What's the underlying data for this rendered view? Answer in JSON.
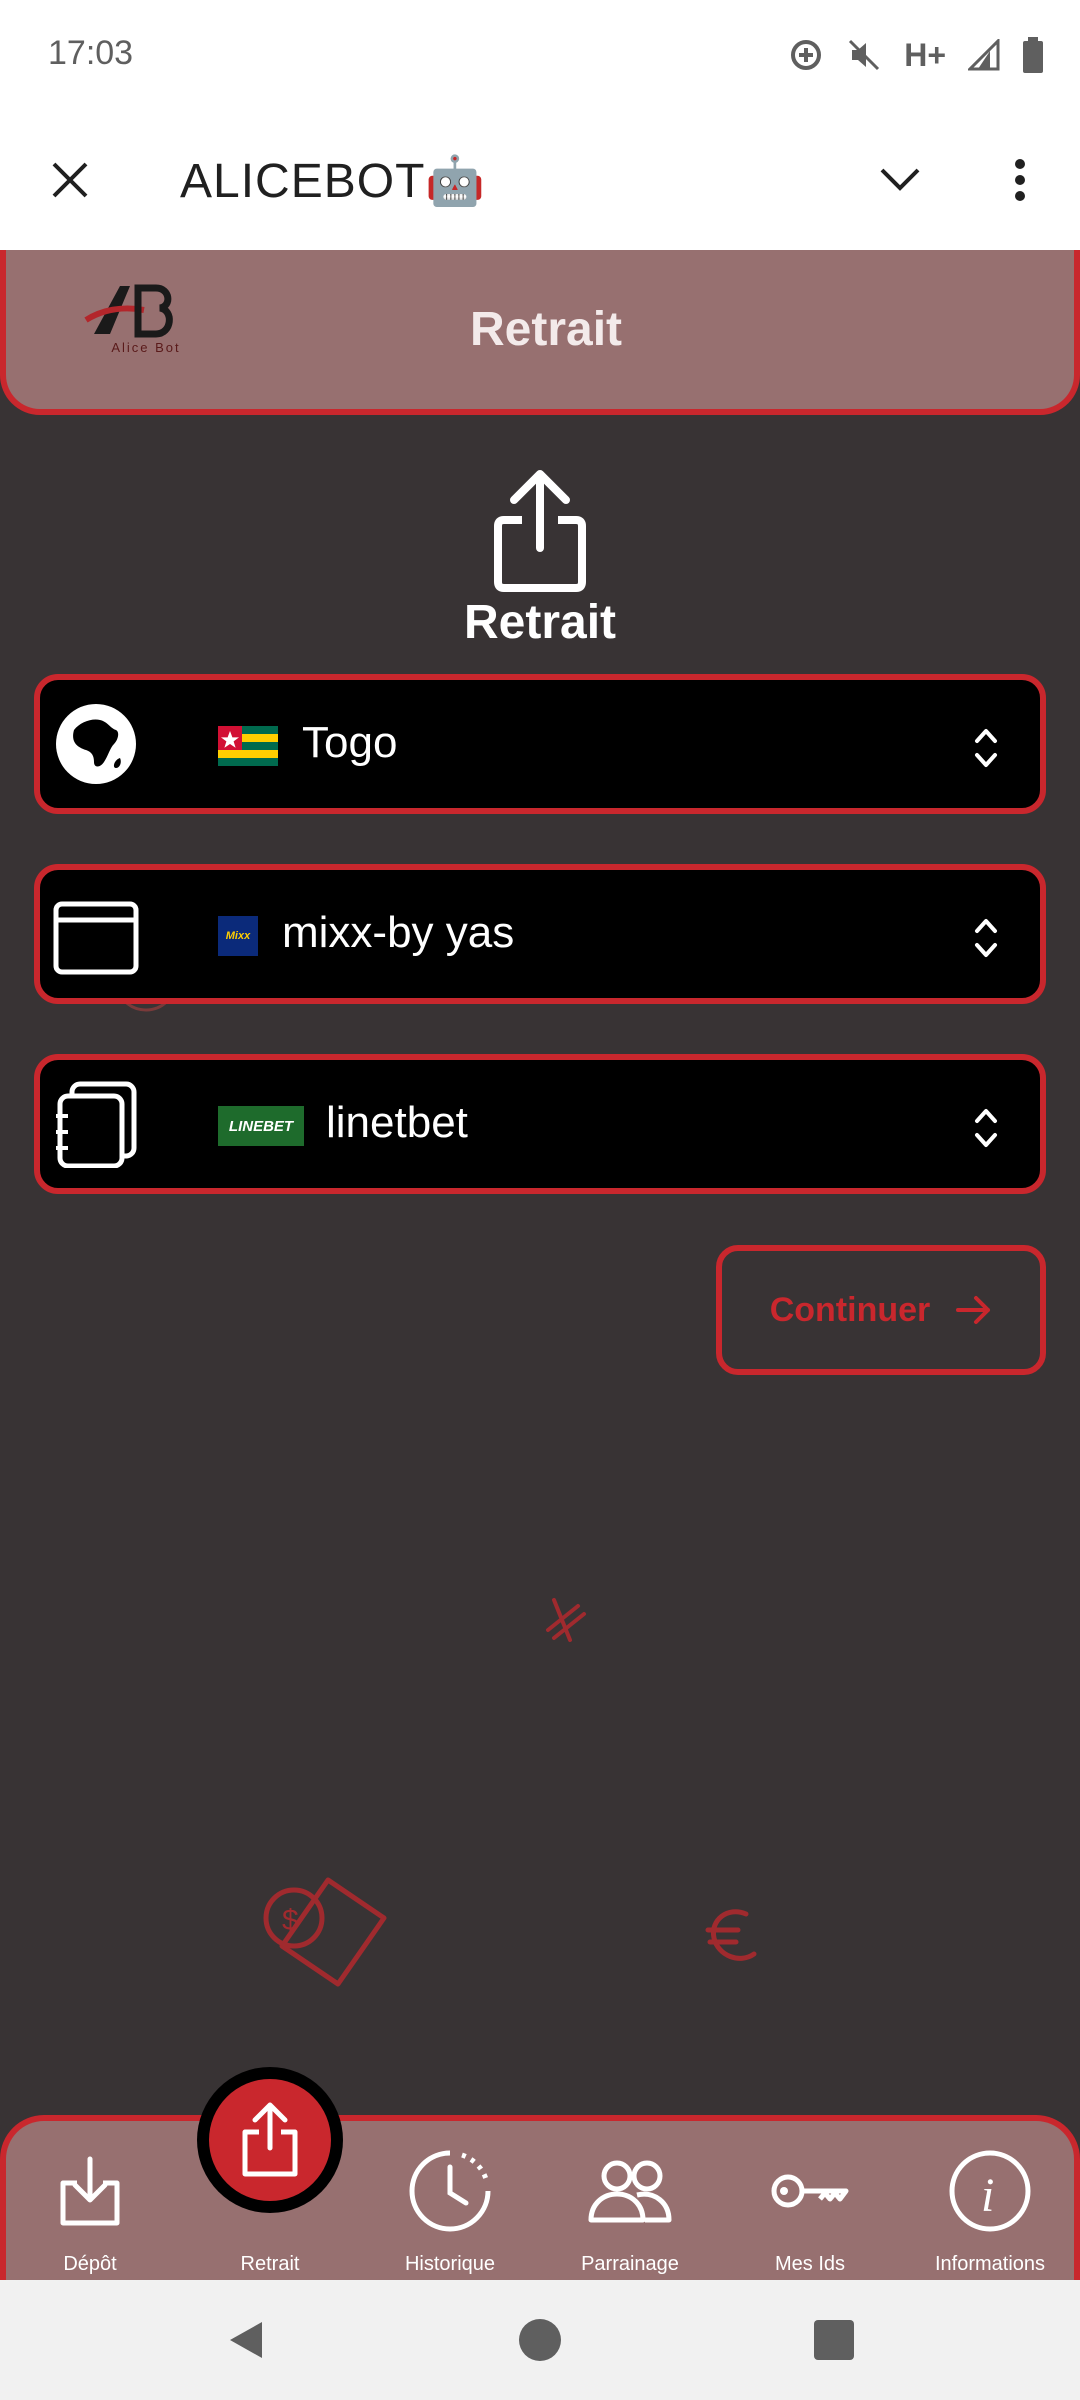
{
  "status_bar": {
    "time": "17:03",
    "network": "H+"
  },
  "app_bar": {
    "title": "ALICEBOT🤖"
  },
  "header": {
    "logo_text": "Alice Bot",
    "title": "Retrait"
  },
  "main": {
    "heading": "Retrait",
    "country_select": {
      "value": "Togo",
      "icon": "globe-africa-icon"
    },
    "provider_select": {
      "value": "mixx-by yas",
      "badge": "Mixx"
    },
    "bookmaker_select": {
      "value": "linetbet",
      "badge": "LINEBET"
    },
    "continue_label": "Continuer"
  },
  "bottom_nav": {
    "items": [
      {
        "label": "Dépôt",
        "icon": "download-icon"
      },
      {
        "label": "Retrait",
        "icon": "upload-icon"
      },
      {
        "label": "Historique",
        "icon": "clock-icon"
      },
      {
        "label": "Parrainage",
        "icon": "users-icon"
      },
      {
        "label": "Mes Ids",
        "icon": "key-icon"
      },
      {
        "label": "Informations",
        "icon": "info-icon"
      }
    ]
  },
  "colors": {
    "accent": "#c9272d",
    "header_bg": "#977070",
    "page_bg": "#383334"
  }
}
